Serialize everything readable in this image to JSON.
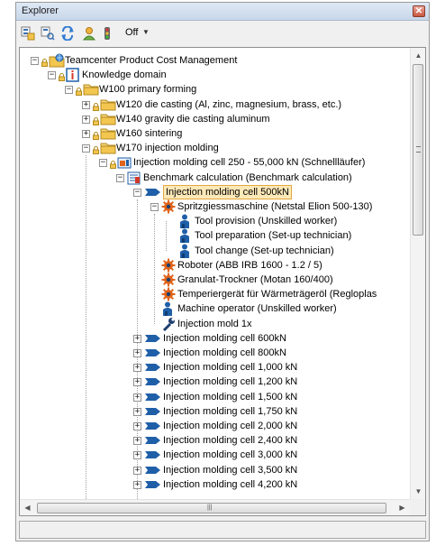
{
  "window": {
    "title": "Explorer",
    "close_glyph": "✕"
  },
  "toolbar": {
    "off_label": "Off",
    "dropdown_glyph": "▼",
    "icons": [
      "structure-view-icon",
      "filter-view-icon",
      "refresh-icon",
      "user-icon",
      "traffic-light-icon"
    ]
  },
  "tree": {
    "items": [
      {
        "label": "Teamcenter Product Cost Management",
        "icon": "globe-folder-icon",
        "expander": "−",
        "lock": true
      },
      {
        "label": "Knowledge domain",
        "icon": "info-icon",
        "expander": "−",
        "lock": true
      },
      {
        "label": "W100 primary forming",
        "icon": "folder-icon",
        "expander": "−",
        "lock": true
      },
      {
        "label": "W120 die casting (Al, zinc, magnesium, brass, etc.)",
        "icon": "folder-icon",
        "expander": "+",
        "lock": true
      },
      {
        "label": "W140 gravity die casting aluminum",
        "icon": "folder-icon",
        "expander": "+",
        "lock": true
      },
      {
        "label": "W160 sintering",
        "icon": "folder-icon",
        "expander": "+",
        "lock": true
      },
      {
        "label": "W170 injection molding",
        "icon": "folder-icon",
        "expander": "−",
        "lock": true
      },
      {
        "label": "Injection molding cell 250 - 55,000 kN (Schnellläufer)",
        "icon": "workcell-icon",
        "expander": "−",
        "lock": true
      },
      {
        "label": "Benchmark calculation (Benchmark calculation)",
        "icon": "calculation-icon",
        "expander": "−",
        "lock": false
      },
      {
        "label": "Injection molding  cell 500kN",
        "icon": "arrow-cell-icon",
        "expander": "−",
        "lock": false,
        "selected": true
      },
      {
        "label": "Spritzgiessmaschine  (Netstal Elion 500-130)",
        "icon": "gear-icon",
        "expander": "−",
        "lock": false
      },
      {
        "label": "Tool provision (Unskilled worker)",
        "icon": "worker-icon",
        "expander": "",
        "lock": false
      },
      {
        "label": "Tool preparation (Set-up technician)",
        "icon": "worker-icon",
        "expander": "",
        "lock": false
      },
      {
        "label": "Tool change (Set-up technician)",
        "icon": "worker-icon",
        "expander": "",
        "lock": false
      },
      {
        "label": "Roboter (ABB IRB 1600 - 1.2 / 5)",
        "icon": "gear-icon",
        "expander": "",
        "lock": false
      },
      {
        "label": "Granulat-Trockner (Motan 160/400)",
        "icon": "gear-icon",
        "expander": "",
        "lock": false
      },
      {
        "label": "Temperiergerät für Wärmeträgeröl (Regloplas",
        "icon": "gear-icon",
        "expander": "",
        "lock": false
      },
      {
        "label": "Machine operator (Unskilled worker)",
        "icon": "worker-icon",
        "expander": "",
        "lock": false
      },
      {
        "label": "Injection mold 1x",
        "icon": "wrench-icon",
        "expander": "",
        "lock": false
      },
      {
        "label": "Injection molding  cell 600kN",
        "icon": "arrow-cell-icon",
        "expander": "+",
        "lock": false
      },
      {
        "label": "Injection molding  cell 800kN",
        "icon": "arrow-cell-icon",
        "expander": "+",
        "lock": false
      },
      {
        "label": "Injection molding  cell 1,000 kN",
        "icon": "arrow-cell-icon",
        "expander": "+",
        "lock": false
      },
      {
        "label": "Injection molding  cell 1,200 kN",
        "icon": "arrow-cell-icon",
        "expander": "+",
        "lock": false
      },
      {
        "label": "Injection molding  cell 1,500 kN",
        "icon": "arrow-cell-icon",
        "expander": "+",
        "lock": false
      },
      {
        "label": "Injection molding  cell 1,750 kN",
        "icon": "arrow-cell-icon",
        "expander": "+",
        "lock": false
      },
      {
        "label": "Injection molding  cell 2,000 kN",
        "icon": "arrow-cell-icon",
        "expander": "+",
        "lock": false
      },
      {
        "label": "Injection molding  cell 2,400 kN",
        "icon": "arrow-cell-icon",
        "expander": "+",
        "lock": false
      },
      {
        "label": "Injection molding  cell 3,000 kN",
        "icon": "arrow-cell-icon",
        "expander": "+",
        "lock": false
      },
      {
        "label": "Injection molding  cell 3,500 kN",
        "icon": "arrow-cell-icon",
        "expander": "+",
        "lock": false
      },
      {
        "label": "Injection molding  cell 4,200 kN",
        "icon": "arrow-cell-icon",
        "expander": "+",
        "lock": false
      }
    ]
  },
  "scrollbars": {
    "up": "▲",
    "down": "▼",
    "left": "◀",
    "right": "▶",
    "h_grip": "|||"
  },
  "status_bar": {
    "text": ""
  },
  "colors": {
    "selection_fill": "#fde9b8",
    "selection_border": "#e3a83f",
    "accent_blue": "#1f5fa8",
    "gear_orange": "#e0641a"
  }
}
